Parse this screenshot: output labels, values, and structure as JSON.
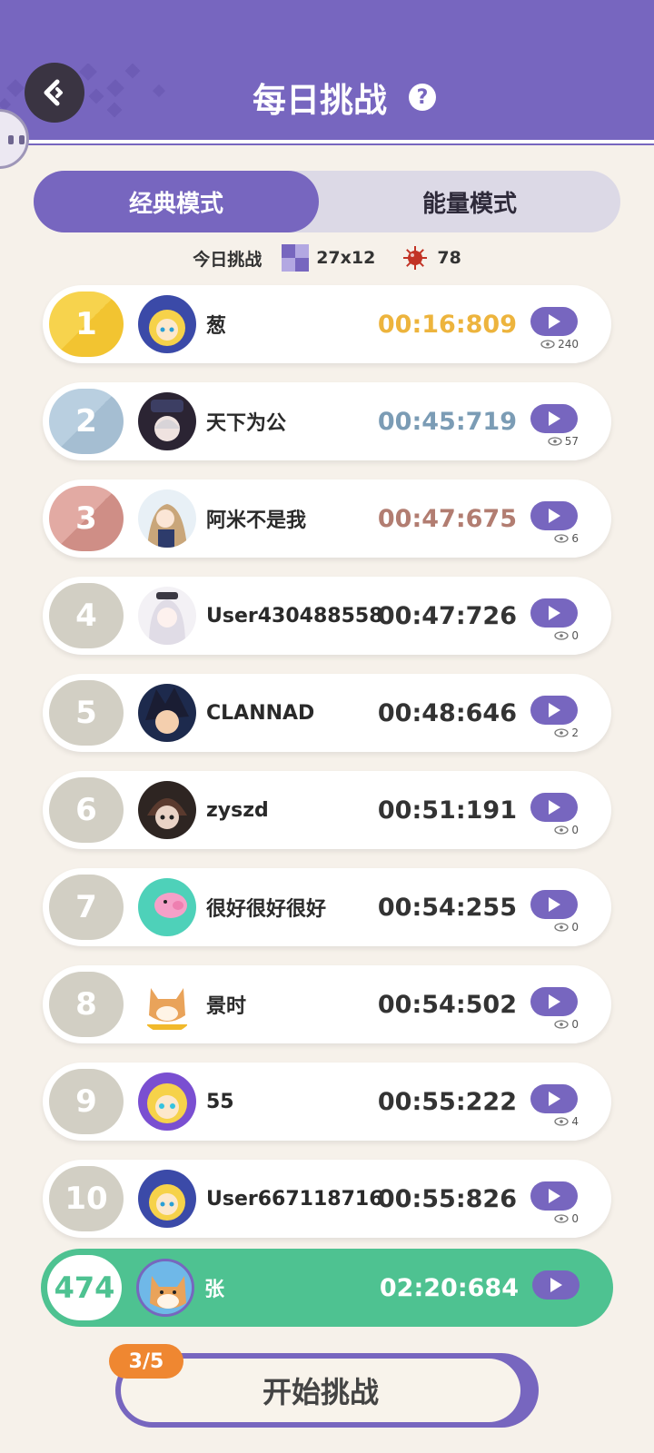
{
  "header": {
    "title": "每日挑战"
  },
  "tabs": [
    {
      "label": "经典模式",
      "active": true
    },
    {
      "label": "能量模式",
      "active": false
    }
  ],
  "info": {
    "label": "今日挑战",
    "board_size": "27x12",
    "mine_count": "78"
  },
  "rows": [
    {
      "rank": "1",
      "name": "葱",
      "time": "00:16:809",
      "views": "240",
      "medal": "gold"
    },
    {
      "rank": "2",
      "name": "天下为公",
      "time": "00:45:719",
      "views": "57",
      "medal": "silver"
    },
    {
      "rank": "3",
      "name": "阿米不是我",
      "time": "00:47:675",
      "views": "6",
      "medal": "bronze"
    },
    {
      "rank": "4",
      "name": "User430488558",
      "time": "00:47:726",
      "views": "0",
      "medal": "none"
    },
    {
      "rank": "5",
      "name": "CLANNAD",
      "time": "00:48:646",
      "views": "2",
      "medal": "none"
    },
    {
      "rank": "6",
      "name": "zyszd",
      "time": "00:51:191",
      "views": "0",
      "medal": "none"
    },
    {
      "rank": "7",
      "name": "很好很好很好",
      "time": "00:54:255",
      "views": "0",
      "medal": "none"
    },
    {
      "rank": "8",
      "name": "景时",
      "time": "00:54:502",
      "views": "0",
      "medal": "none"
    },
    {
      "rank": "9",
      "name": "55",
      "time": "00:55:222",
      "views": "4",
      "medal": "none"
    },
    {
      "rank": "10",
      "name": "User667118716",
      "time": "00:55:826",
      "views": "0",
      "medal": "none"
    }
  ],
  "me": {
    "rank": "474",
    "name": "张",
    "time": "02:20:684"
  },
  "start": {
    "label": "开始挑战",
    "attempts": "3/5"
  },
  "colors": {
    "primary": "#7766bf",
    "gold": "#edb43d",
    "silver": "#7b9cb5",
    "bronze": "#b27d71",
    "me": "#4ec291",
    "badge": "#ef8731"
  }
}
